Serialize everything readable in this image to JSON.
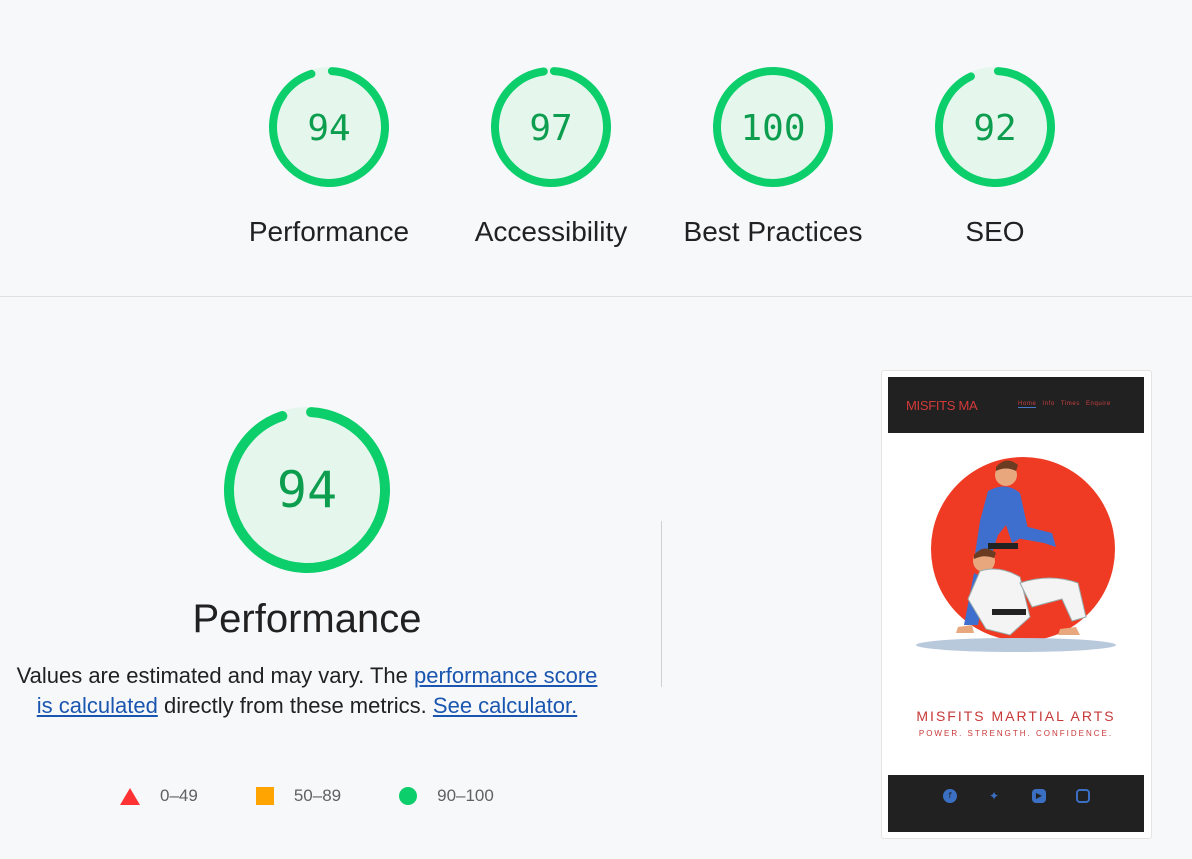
{
  "scores": [
    {
      "value": "94",
      "score": 94,
      "label": "Performance"
    },
    {
      "value": "97",
      "score": 97,
      "label": "Accessibility"
    },
    {
      "value": "100",
      "score": 100,
      "label": "Best Practices"
    },
    {
      "value": "92",
      "score": 92,
      "label": "SEO"
    }
  ],
  "performance": {
    "value": "94",
    "score": 94,
    "title": "Performance",
    "desc_before": "Values are estimated and may vary. The ",
    "link_score": "performance score is calculated",
    "desc_middle": " directly from these metrics. ",
    "link_calc": "See calculator."
  },
  "legend": [
    {
      "range": "0–49",
      "shape": "triangle",
      "color": "#ff3333"
    },
    {
      "range": "50–89",
      "shape": "square",
      "color": "#ffa400"
    },
    {
      "range": "90–100",
      "shape": "circle",
      "color": "#0cce6b"
    }
  ],
  "thumbnail": {
    "brand": "MISFITS MA",
    "nav": [
      "Home",
      "Info",
      "Times",
      "Enquire"
    ],
    "title": "MISFITS MARTIAL ARTS",
    "tagline": "POWER. STRENGTH. CONFIDENCE.",
    "social_icons": [
      "facebook-icon",
      "twitter-icon",
      "youtube-icon",
      "instagram-icon"
    ]
  },
  "colors": {
    "pass": "#0cce6b",
    "pass_text": "#0c9e4e",
    "pass_fill": "#e5f7ed",
    "link": "#1a56b0"
  }
}
